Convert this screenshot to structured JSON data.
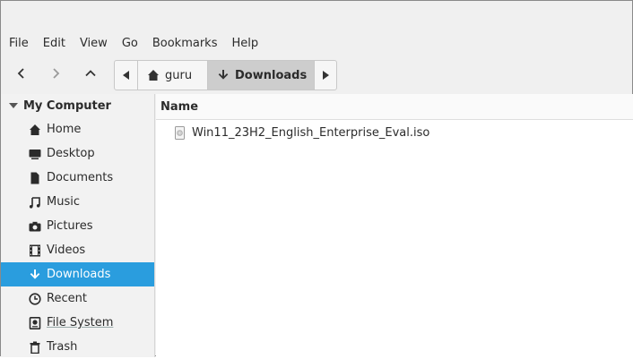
{
  "menu": [
    "File",
    "Edit",
    "View",
    "Go",
    "Bookmarks",
    "Help"
  ],
  "toolbar": {
    "back_icon": "chevron-left-icon",
    "forward_icon": "chevron-right-icon",
    "up_icon": "chevron-up-icon"
  },
  "pathbar": {
    "segments": [
      {
        "label": "guru",
        "icon": "home-icon"
      },
      {
        "label": "Downloads",
        "icon": "download-icon"
      }
    ],
    "active_index": 1
  },
  "sidebar": {
    "header": "My Computer",
    "items": [
      {
        "label": "Home",
        "icon": "home-icon"
      },
      {
        "label": "Desktop",
        "icon": "desktop-icon"
      },
      {
        "label": "Documents",
        "icon": "document-icon"
      },
      {
        "label": "Music",
        "icon": "music-icon"
      },
      {
        "label": "Pictures",
        "icon": "camera-icon"
      },
      {
        "label": "Videos",
        "icon": "film-icon"
      },
      {
        "label": "Downloads",
        "icon": "download-icon"
      },
      {
        "label": "Recent",
        "icon": "clock-icon"
      },
      {
        "label": "File System",
        "icon": "drive-icon"
      },
      {
        "label": "Trash",
        "icon": "trash-icon"
      }
    ],
    "selected_index": 6
  },
  "content": {
    "columns": [
      "Name"
    ],
    "files": [
      {
        "name": "Win11_23H2_English_Enterprise_Eval.iso",
        "icon": "disc-image-icon"
      }
    ]
  },
  "colors": {
    "selection": "#2a9dde",
    "active_path_segment": "#cdcdcd"
  }
}
